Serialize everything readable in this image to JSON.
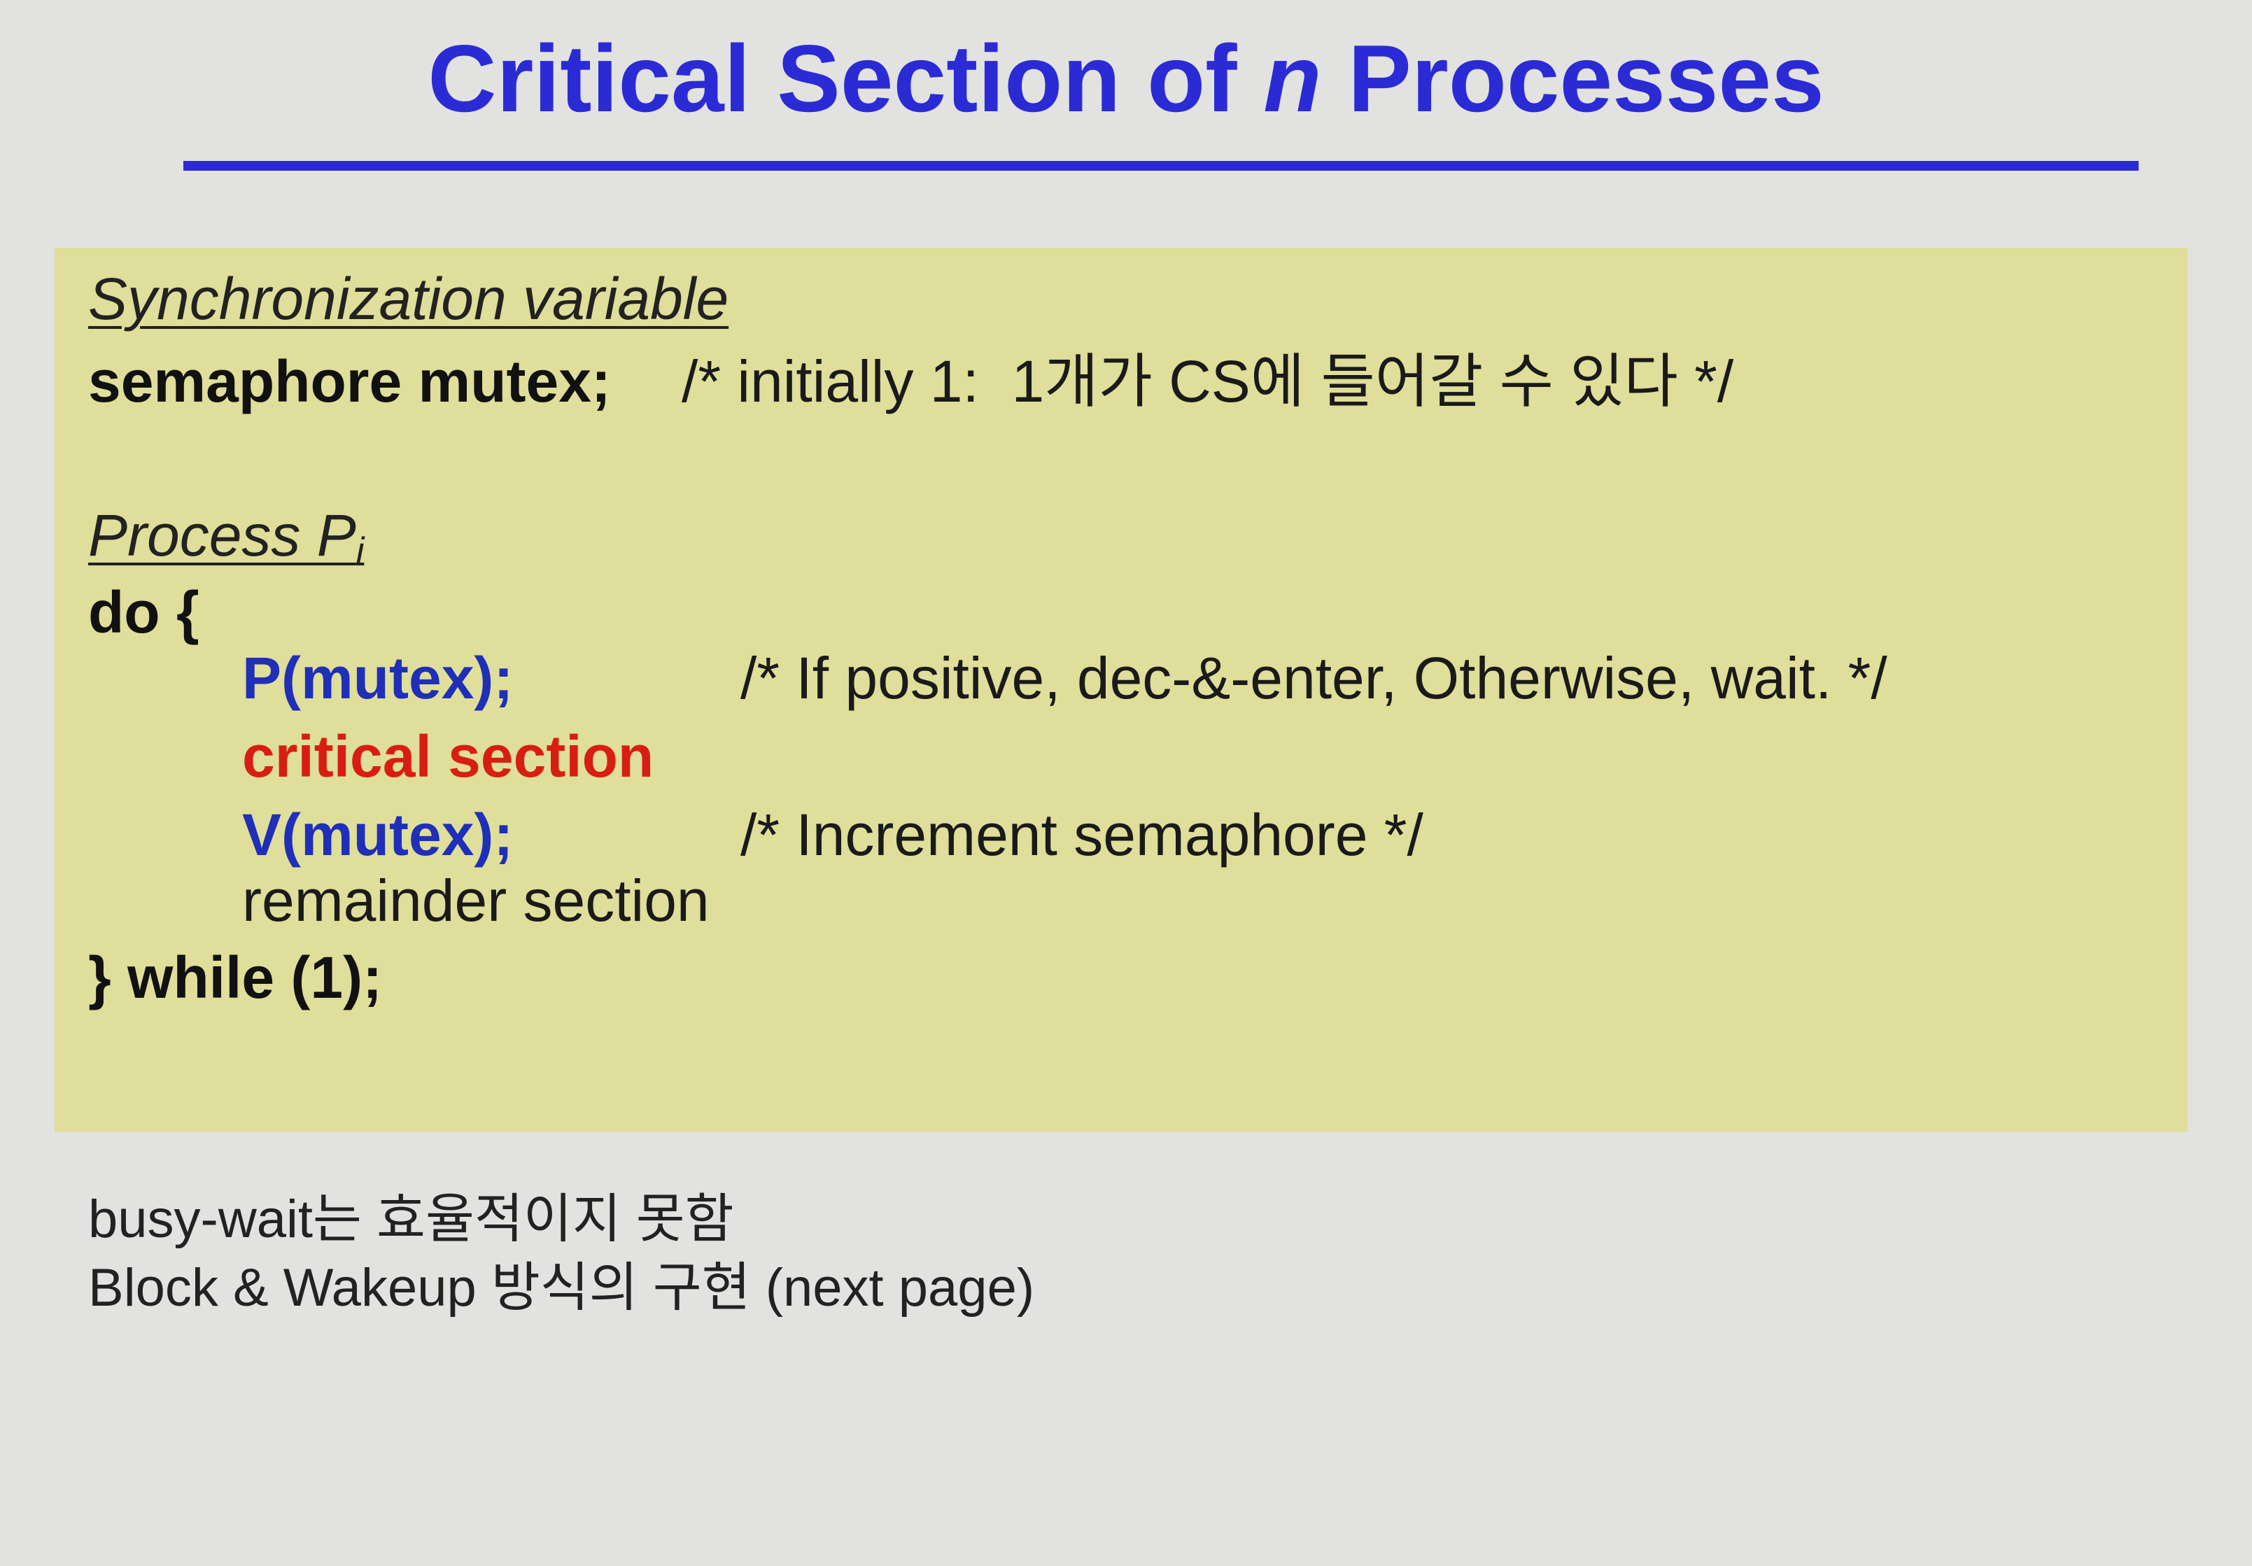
{
  "title": {
    "prefix": "Critical Section of ",
    "italic": "n",
    "suffix": " Processes"
  },
  "code": {
    "sync_heading": "Synchronization variable",
    "semaphore_decl": "semaphore mutex;",
    "semaphore_comment": "/* initially 1:  1개가 CS에 들어갈 수 있다 */",
    "process_heading": "Process P",
    "process_subscript": "i",
    "do_open": "do {",
    "p_call": "P(mutex);",
    "p_comment": "/* If positive, dec-&-enter, Otherwise, wait. */",
    "critical_section": "critical section",
    "v_call": "V(mutex);",
    "v_comment": "/* Increment semaphore */",
    "remainder_section": "remainder section",
    "while_close": "} while (1);"
  },
  "notes": {
    "line1": "busy-wait는 효율적이지 못함",
    "line2": "Block & Wakeup 방식의 구현 (next page)"
  },
  "colors": {
    "title": "#2b2bd6",
    "code_box": "#dfde9a",
    "keyword_blue": "#1f2fb8",
    "critical_red": "#d81e12",
    "background": "#e2e2e0"
  }
}
